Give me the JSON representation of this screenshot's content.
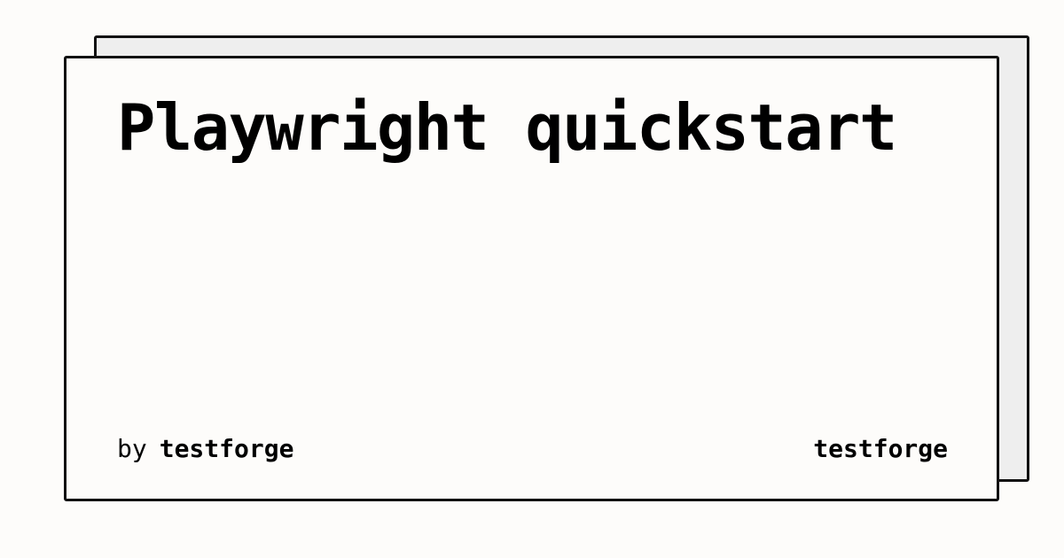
{
  "card": {
    "title": "Playwright quickstart",
    "byline_prefix": "by",
    "author": "testforge",
    "brand": "testforge"
  }
}
